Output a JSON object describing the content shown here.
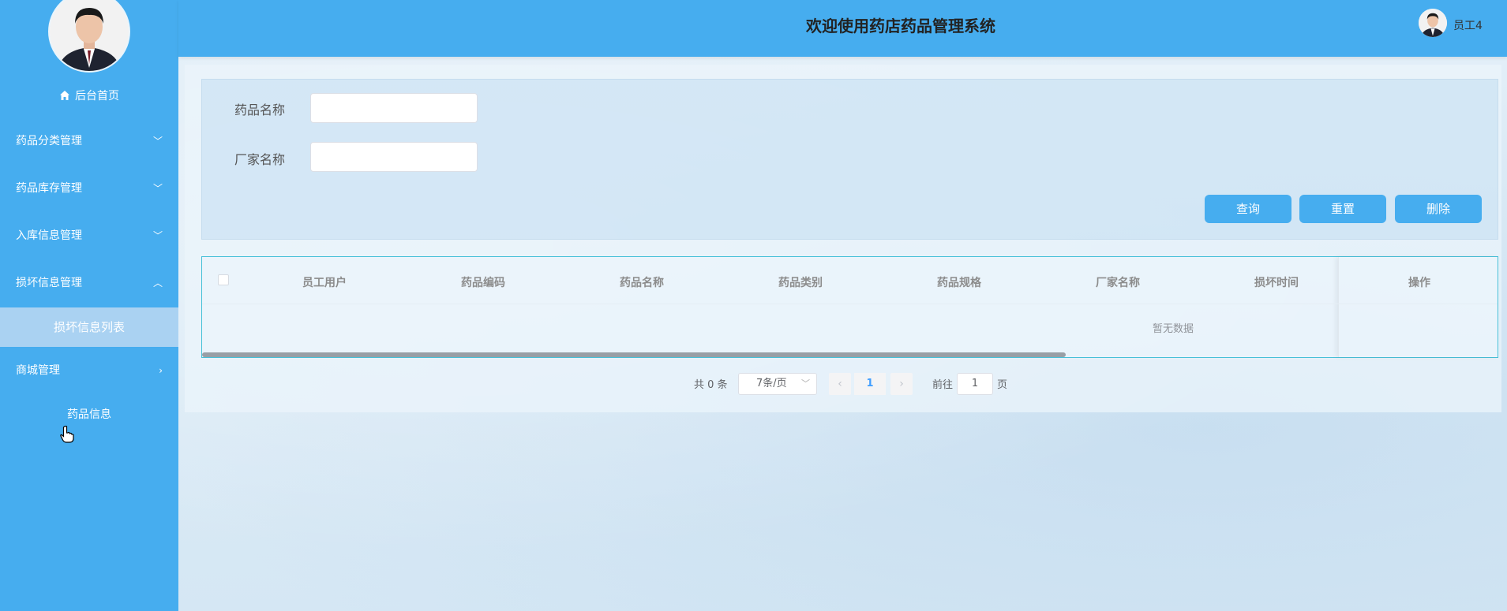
{
  "app": {
    "title": "欢迎使用药店药品管理系统"
  },
  "user": {
    "name": "员工4"
  },
  "sidebar": {
    "home": "后台首页",
    "items": [
      {
        "label": "药品分类管理",
        "expanded": false
      },
      {
        "label": "药品库存管理",
        "expanded": false
      },
      {
        "label": "入库信息管理",
        "expanded": false
      },
      {
        "label": "损坏信息管理",
        "expanded": true
      },
      {
        "label": "商城管理",
        "expanded": false
      }
    ],
    "active_sub": "损坏信息列表",
    "mall_sub": "药品信息"
  },
  "search": {
    "drug_name_label": "药品名称",
    "drug_name_value": "",
    "maker_label": "厂家名称",
    "maker_value": "",
    "query_button": "查询",
    "reset_button": "重置",
    "delete_button": "删除"
  },
  "table": {
    "columns": [
      "员工用户",
      "药品编码",
      "药品名称",
      "药品类别",
      "药品规格",
      "厂家名称",
      "损坏时间",
      "操作"
    ],
    "empty_text": "暂无数据"
  },
  "pagination": {
    "total": "共 0 条",
    "page_size": "7条/页",
    "current_page": "1",
    "goto_label": "前往",
    "goto_value": "1",
    "page_suffix": "页",
    "prev_icon": "‹",
    "next_icon": "›"
  },
  "colors": {
    "primary": "#46adef",
    "sub_active": "#aad2f2",
    "table_border": "#46c0d8"
  }
}
